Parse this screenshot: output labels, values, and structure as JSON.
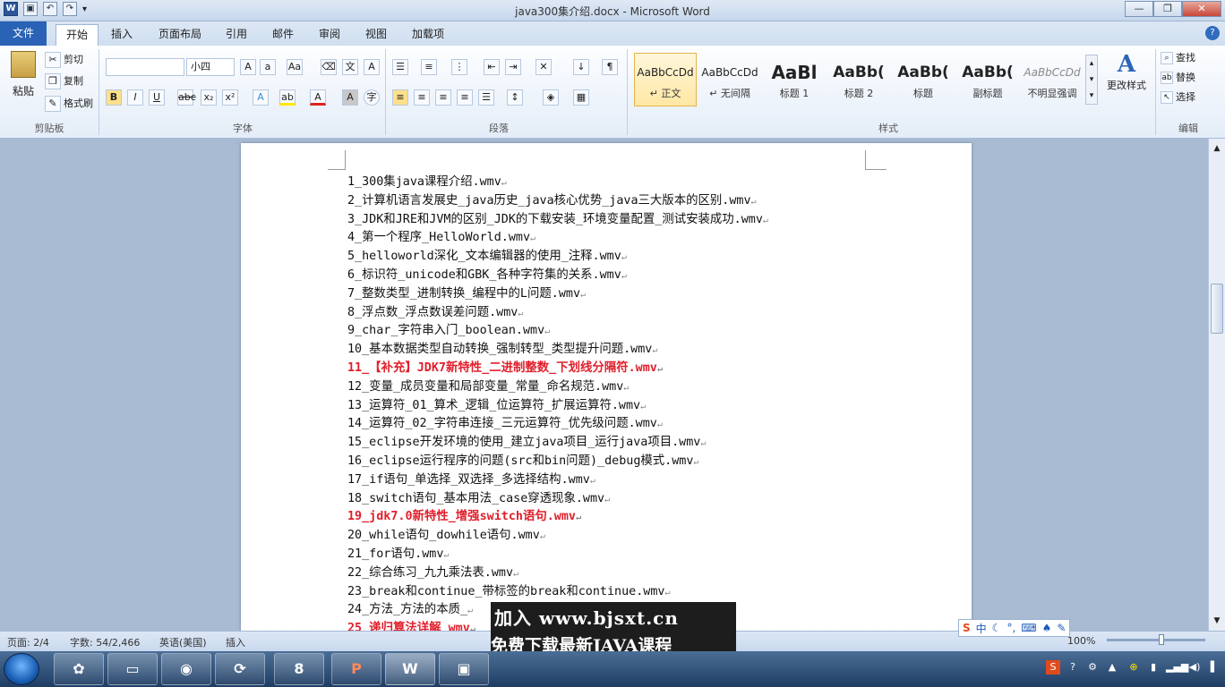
{
  "window": {
    "title": "java300集介绍.docx - Microsoft Word",
    "min": "—",
    "max": "❐",
    "close": "✕"
  },
  "tabs": [
    "文件",
    "开始",
    "插入",
    "页面布局",
    "引用",
    "邮件",
    "审阅",
    "视图",
    "加载项"
  ],
  "clipboard": {
    "paste": "粘贴",
    "cut": "剪切",
    "copy": "复制",
    "painter": "格式刷",
    "label": "剪贴板"
  },
  "font": {
    "name": "",
    "size": "小四",
    "label": "字体"
  },
  "paragraph": {
    "label": "段落"
  },
  "styles": {
    "items": [
      {
        "preview": "AaBbCcDd",
        "name": "↵ 正文"
      },
      {
        "preview": "AaBbCcDd",
        "name": "↵ 无间隔"
      },
      {
        "preview": "AaBl",
        "name": "标题 1"
      },
      {
        "preview": "AaBb(",
        "name": "标题 2"
      },
      {
        "preview": "AaBb(",
        "name": "标题"
      },
      {
        "preview": "AaBb(",
        "name": "副标题"
      },
      {
        "preview": "AaBbCcDd",
        "name": "不明显强调"
      }
    ],
    "change": "更改样式",
    "label": "样式"
  },
  "editing": {
    "find": "查找",
    "replace": "替换",
    "select": "选择",
    "label": "编辑"
  },
  "document": {
    "lines": [
      {
        "text": "1_300集java课程介绍.wmv",
        "red": false
      },
      {
        "text": "2_计算机语言发展史_java历史_java核心优势_java三大版本的区别.wmv",
        "red": false
      },
      {
        "text": "3_JDK和JRE和JVM的区别_JDK的下载安装_环境变量配置_测试安装成功.wmv",
        "red": false
      },
      {
        "text": "4_第一个程序_HelloWorld.wmv",
        "red": false
      },
      {
        "text": "5_helloworld深化_文本编辑器的使用_注释.wmv",
        "red": false
      },
      {
        "text": "6_标识符_unicode和GBK_各种字符集的关系.wmv",
        "red": false
      },
      {
        "text": "7_整数类型_进制转换_编程中的L问题.wmv",
        "red": false
      },
      {
        "text": "8_浮点数_浮点数误差问题.wmv",
        "red": false
      },
      {
        "text": "9_char_字符串入门_boolean.wmv",
        "red": false
      },
      {
        "text": "10_基本数据类型自动转换_强制转型_类型提升问题.wmv",
        "red": false
      },
      {
        "text": "11_【补充】JDK7新特性_二进制整数_下划线分隔符.wmv",
        "red": true
      },
      {
        "text": "12_变量_成员变量和局部变量_常量_命名规范.wmv",
        "red": false
      },
      {
        "text": "13_运算符_01_算术_逻辑_位运算符_扩展运算符.wmv",
        "red": false
      },
      {
        "text": "14_运算符_02_字符串连接_三元运算符_优先级问题.wmv",
        "red": false
      },
      {
        "text": "15_eclipse开发环境的使用_建立java项目_运行java项目.wmv",
        "red": false
      },
      {
        "text": "16_eclipse运行程序的问题(src和bin问题)_debug模式.wmv",
        "red": false
      },
      {
        "text": "17_if语句_单选择_双选择_多选择结构.wmv",
        "red": false
      },
      {
        "text": "18_switch语句_基本用法_case穿透现象.wmv",
        "red": false
      },
      {
        "text": "19_jdk7.0新特性_增强switch语句.wmv",
        "red": true
      },
      {
        "text": "20_while语句_dowhile语句.wmv",
        "red": false
      },
      {
        "text": "21_for语句.wmv",
        "red": false
      },
      {
        "text": "22_综合练习_九九乘法表.wmv",
        "red": false
      },
      {
        "text": "23_break和continue_带标签的break和continue.wmv",
        "red": false
      },
      {
        "text": "24_方法_方法的本质_",
        "red": false
      },
      {
        "text": "25_递归算法详解_wmv",
        "red": true
      }
    ]
  },
  "status": {
    "page": "页面: 2/4",
    "words": "字数: 54/2,466",
    "lang": "英语(美国)",
    "mode": "插入",
    "zoom": "100%"
  },
  "ime": {
    "lang": "中"
  },
  "watermark": {
    "line1": "加入 www.bjsxt.cn",
    "line2": "免费下载最新JAVA课程"
  }
}
